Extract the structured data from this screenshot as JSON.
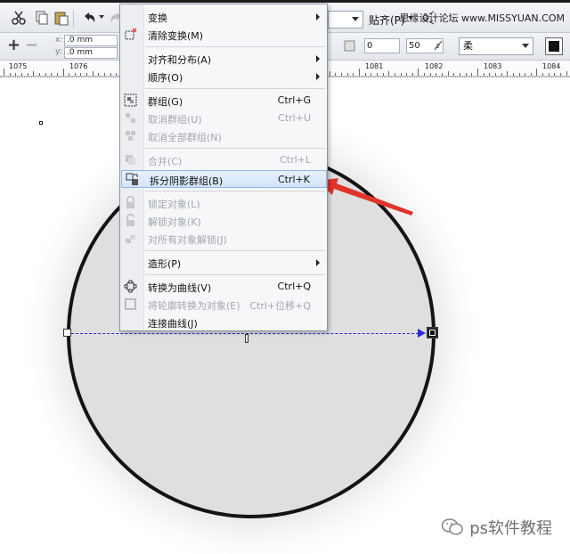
{
  "toolbar": {
    "paste_label": "贴齐(P)",
    "watermark": "思缘设计论坛 www.MISSYUAN.COM"
  },
  "property_bar": {
    "x_label": "x:",
    "y_label": "y:",
    "x_value": ".0 mm",
    "y_value": ".0 mm",
    "field_a": "0",
    "field_b": "50",
    "style_select": "柔"
  },
  "ruler": {
    "labels": [
      "1075",
      "1076",
      "1081",
      "1082",
      "1083",
      "1084"
    ]
  },
  "menu": {
    "items": [
      {
        "label": "变换",
        "shortcut": "",
        "disabled": false,
        "submenu": true
      },
      {
        "label": "清除变换(M)",
        "shortcut": "",
        "disabled": false,
        "submenu": false
      },
      {
        "label": "对齐和分布(A)",
        "shortcut": "",
        "disabled": false,
        "submenu": true
      },
      {
        "label": "顺序(O)",
        "shortcut": "",
        "disabled": false,
        "submenu": true
      },
      {
        "label": "群组(G)",
        "shortcut": "Ctrl+G",
        "disabled": false,
        "submenu": false
      },
      {
        "label": "取消群组(U)",
        "shortcut": "Ctrl+U",
        "disabled": true,
        "submenu": false
      },
      {
        "label": "取消全部群组(N)",
        "shortcut": "",
        "disabled": true,
        "submenu": false
      },
      {
        "label": "合并(C)",
        "shortcut": "Ctrl+L",
        "disabled": true,
        "submenu": false
      },
      {
        "label": "拆分阴影群组(B)",
        "shortcut": "Ctrl+K",
        "disabled": false,
        "submenu": false,
        "highlighted": true
      },
      {
        "label": "锁定对象(L)",
        "shortcut": "",
        "disabled": true,
        "submenu": false
      },
      {
        "label": "解锁对象(K)",
        "shortcut": "",
        "disabled": true,
        "submenu": false
      },
      {
        "label": "对所有对象解锁(J)",
        "shortcut": "",
        "disabled": true,
        "submenu": false
      },
      {
        "label": "造形(P)",
        "shortcut": "",
        "disabled": false,
        "submenu": true
      },
      {
        "label": "转换为曲线(V)",
        "shortcut": "Ctrl+Q",
        "disabled": false,
        "submenu": false
      },
      {
        "label": "将轮廓转换为对象(E)",
        "shortcut": "Ctrl+位移+Q",
        "disabled": true,
        "submenu": false
      },
      {
        "label": "连接曲线(J)",
        "shortcut": "",
        "disabled": false,
        "submenu": false
      }
    ]
  },
  "footer": {
    "brand": "ps软件教程"
  },
  "colors": {
    "highlight": "#d3e5fa",
    "accent_red": "#e0332b",
    "guide_blue": "#2b2bd0"
  }
}
